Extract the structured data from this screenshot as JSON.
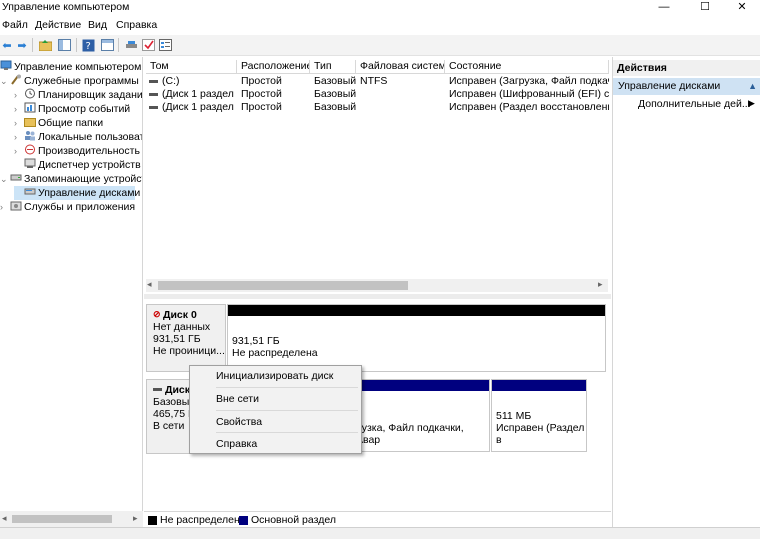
{
  "window": {
    "title": "Управление компьютером"
  },
  "menu": [
    "Файл",
    "Действие",
    "Вид",
    "Справка"
  ],
  "tree": {
    "root": "Управление компьютером (л",
    "system_tools": "Служебные программы",
    "task_scheduler": "Планировщик заданий",
    "event_viewer": "Просмотр событий",
    "shared_folders": "Общие папки",
    "local_users": "Локальные пользовате",
    "performance": "Производительность",
    "device_manager": "Диспетчер устройств",
    "storage": "Запоминающие устройст",
    "disk_management": "Управление дисками",
    "services_apps": "Службы и приложения"
  },
  "volume_list": {
    "headers": {
      "volume": "Том",
      "layout": "Расположение",
      "type": "Тип",
      "fs": "Файловая система",
      "status": "Состояние"
    },
    "rows": [
      {
        "volume": "(C:)",
        "layout": "Простой",
        "type": "Базовый",
        "fs": "NTFS",
        "status": "Исправен (Загрузка, Файл подкачки,"
      },
      {
        "volume": "(Диск 1 раздел 1)",
        "layout": "Простой",
        "type": "Базовый",
        "fs": "",
        "status": "Исправен (Шифрованный (EFI) систе"
      },
      {
        "volume": "(Диск 1 раздел 4)",
        "layout": "Простой",
        "type": "Базовый",
        "fs": "",
        "status": "Исправен (Раздел восстановления)"
      }
    ]
  },
  "disk0": {
    "name": "Диск 0",
    "state": "Нет данных",
    "size": "931,51 ГБ",
    "init": "Не проиници...",
    "part_size": "931,51 ГБ",
    "part_status": "Не распределена"
  },
  "disk1": {
    "name": "Диск",
    "type": "Базовый",
    "size": "465,75 ГБ",
    "state": "В сети",
    "c_status": "рузка, Файл подкачки, Авар",
    "recovery_size": "511 МБ",
    "recovery_status": "Исправен (Раздел в"
  },
  "legend": {
    "unallocated": "Не распределена",
    "primary": "Основной раздел"
  },
  "actions": {
    "title": "Действия",
    "section": "Управление дисками",
    "more": "Дополнительные дей..."
  },
  "context_menu": [
    "Инициализировать диск",
    "Вне сети",
    "Свойства",
    "Справка"
  ],
  "colors": {
    "unallocated": "#000000",
    "primary": "#00007f",
    "selection": "#cce4f7"
  }
}
